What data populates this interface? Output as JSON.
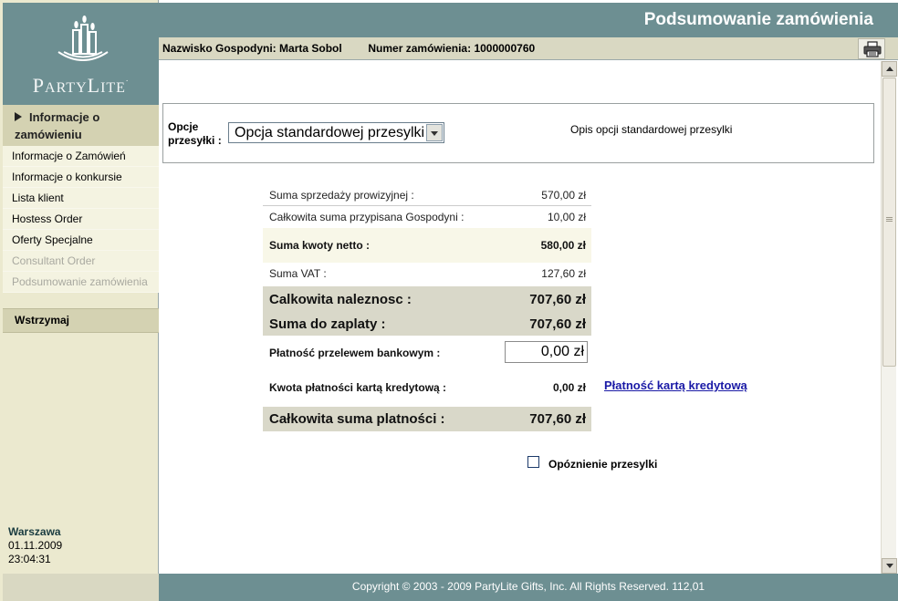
{
  "brand": {
    "logo_text": "PartyLite",
    "logo_icon": "candles-icon"
  },
  "header": {
    "title": "Podsumowanie zamówienia",
    "hostess_label": "Nazwisko Gospodyni:",
    "hostess_name": "Marta Sobol",
    "order_label": "Numer zamówienia:",
    "order_number": "1000000760",
    "print_icon": "printer-icon"
  },
  "sidebar": {
    "section_title": "Informacje o zamówieniu",
    "items": [
      {
        "label": "Informacje o Zamówień",
        "enabled": true
      },
      {
        "label": "Informacje o konkursie",
        "enabled": true
      },
      {
        "label": "Lista klient",
        "enabled": true
      },
      {
        "label": "Hostess Order",
        "enabled": true
      },
      {
        "label": "Oferty Specjalne",
        "enabled": true
      },
      {
        "label": "Consultant Order",
        "enabled": false
      },
      {
        "label": "Podsumowanie zamówienia",
        "enabled": false
      }
    ],
    "hold_button": "Wstrzymaj",
    "city": "Warszawa",
    "date": "01.11.2009",
    "time": "23:04:31"
  },
  "shipping": {
    "label": "Opcje przesyłki :",
    "selected": "Opcja standardowej przesylki",
    "description": "Opis opcji standardowej przesylki"
  },
  "summary": {
    "commission_sales_label": "Suma sprzedaży prowizyjnej :",
    "commission_sales_value": "570,00 zł",
    "hostess_total_label": "Całkowita suma przypisana Gospodyni :",
    "hostess_total_value": "10,00 zł",
    "net_label": "Suma kwoty netto :",
    "net_value": "580,00 zł",
    "vat_label": "Suma VAT :",
    "vat_value": "127,60 zł",
    "total_due_label": "Calkowita naleznosc :",
    "total_due_value": "707,60 zł",
    "to_pay_label": "Suma do zaplaty :",
    "to_pay_value": "707,60 zł",
    "bank_transfer_label": "Płatność przelewem bankowym :",
    "bank_transfer_value": "0,00 zł",
    "card_label": "Kwota płatności kartą kredytową :",
    "card_value": "0,00 zł",
    "total_payments_label": "Całkowita suma platności :",
    "total_payments_value": "707,60 zł"
  },
  "card_link": "Płatność kartą kredytową",
  "delay": {
    "label": "Opóznienie przesylki",
    "checked": false
  },
  "footer": {
    "copyright": "Copyright © 2003 - 2009 PartyLite Gifts, Inc. All Rights Reserved.  112,01"
  },
  "colors": {
    "teal": "#6d8f92",
    "sidebar": "#ebe9cf",
    "band": "#d9d8c9",
    "link": "#1a1aa6"
  }
}
